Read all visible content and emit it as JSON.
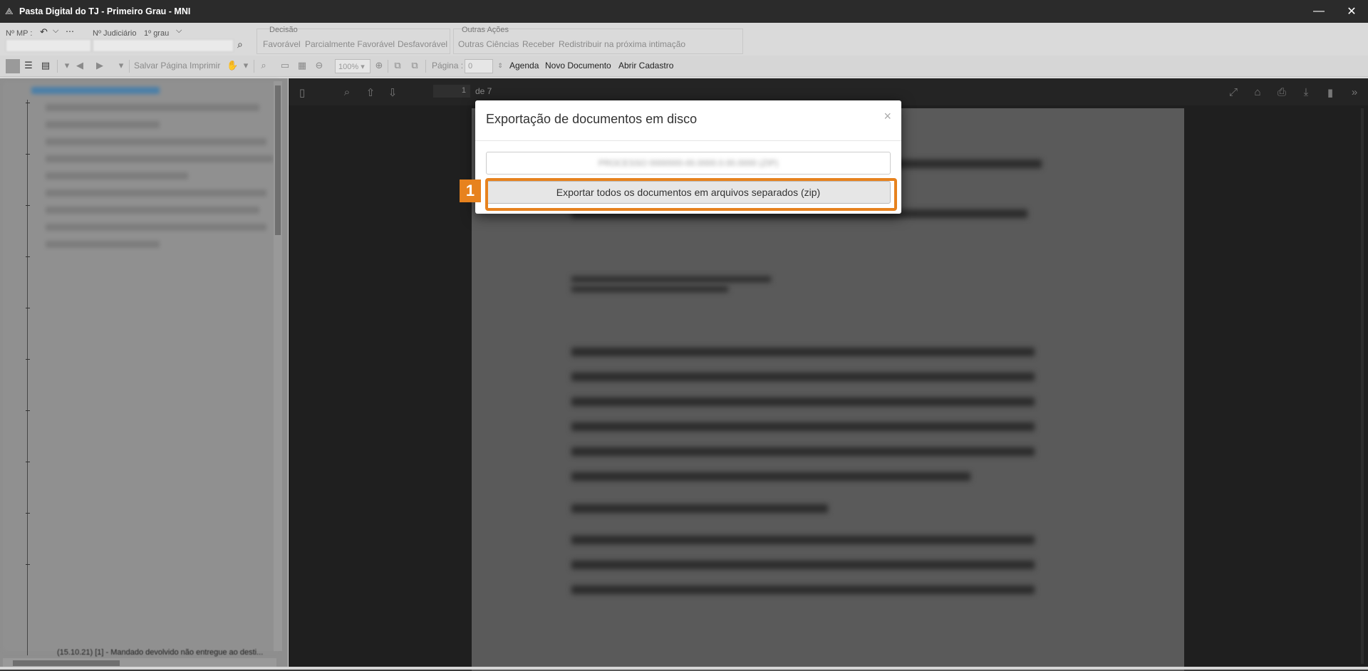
{
  "window": {
    "title": "Pasta Digital do TJ - Primeiro Grau - MNI",
    "minimize_glyph": "—",
    "close_glyph": "✕"
  },
  "ribbon": {
    "mp_label": "Nº MP :",
    "judicial_label": "Nº Judiciário",
    "grau_label": "1º grau",
    "decisao_title": "Decisão",
    "decisao_buttons": [
      "Favorável",
      "Parcialmente Favorável",
      "Desfavorável"
    ],
    "outras_title": "Outras Ações",
    "outras_buttons": [
      "Outras Ciências",
      "Receber",
      "Redistribuir na próxima intimação"
    ]
  },
  "toolbar": {
    "salvar": "Salvar Página",
    "imprimir": "Imprimir",
    "zoom": "100%",
    "pagina_label": "Página :",
    "pagina_value": "0",
    "agenda": "Agenda",
    "novo_documento": "Novo Documento",
    "abrir_cadastro": "Abrir Cadastro"
  },
  "sidebar": {
    "bottom_item": "(15.10.21) [1] - Mandado devolvido não entregue ao desti..."
  },
  "viewer": {
    "page_number": "1",
    "page_of": "de 7"
  },
  "modal": {
    "title": "Exportação de documentos em disco",
    "close": "×",
    "filename_placeholder": "PROCESSO 0000000-00.0000.0.00.0000 (ZIP)",
    "export_button": "Exportar todos os documentos em arquivos separados (zip)"
  },
  "annotation": {
    "step_number": "1",
    "highlight_color": "#e7821e"
  }
}
